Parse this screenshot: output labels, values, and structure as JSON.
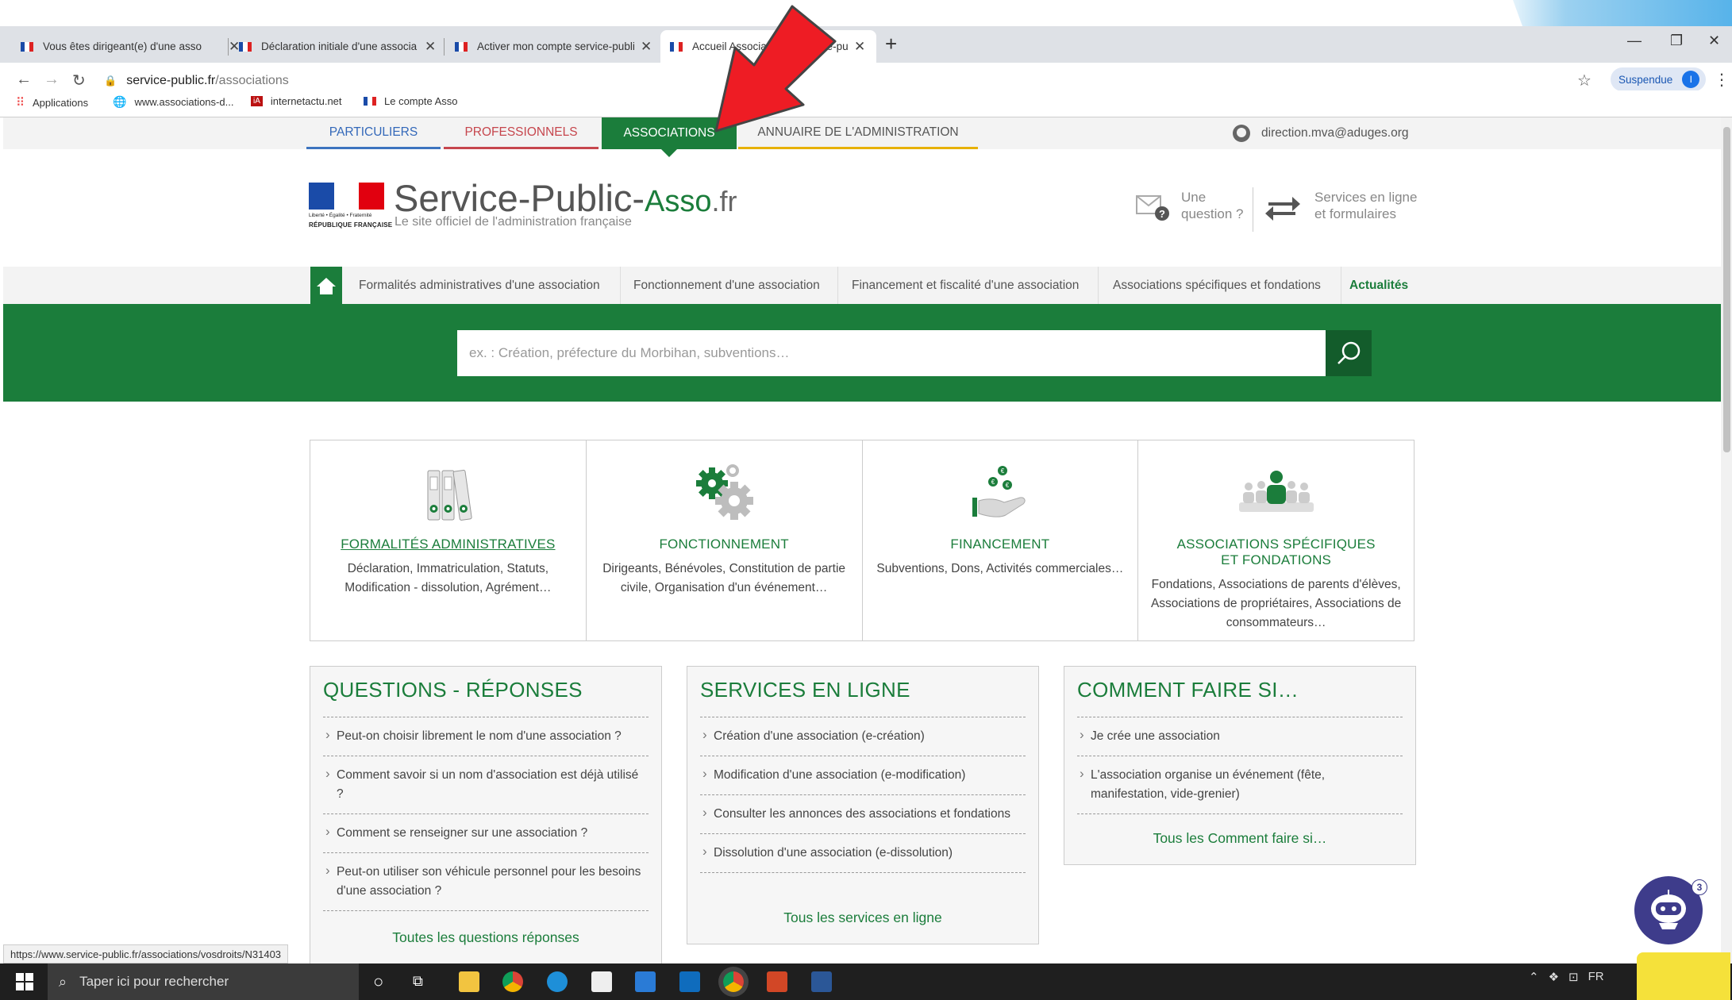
{
  "browser": {
    "tabs": [
      {
        "label": "Vous êtes dirigeant(e) d'une asso",
        "active": false
      },
      {
        "label": "Déclaration initiale d'une associa",
        "active": false
      },
      {
        "label": "Activer mon compte service-publi",
        "active": false
      },
      {
        "label": "Accueil Associations - service-pub",
        "active": true
      }
    ],
    "url_host": "service-public.fr",
    "url_path": "/associations",
    "profile_label": "Suspendue",
    "profile_initial": "I",
    "bookmarks": [
      "Applications",
      "www.associations-d...",
      "internetactu.net",
      "Le compte Asso"
    ]
  },
  "site": {
    "topnav": {
      "particuliers": "PARTICULIERS",
      "professionnels": "PROFESSIONNELS",
      "associations": "ASSOCIATIONS",
      "annuaire": "ANNUAIRE DE L'ADMINISTRATION"
    },
    "user_email": "direction.mva@aduges.org",
    "logo": {
      "motto": "Liberté • Égalité • Fraternité",
      "rf": "RÉPUBLIQUE FRANÇAISE"
    },
    "brand": {
      "main": "Service-Public-",
      "asso": "Asso",
      "fr": ".fr"
    },
    "tagline": "Le site officiel de l'administration française",
    "header_links": {
      "question_line1": "Une",
      "question_line2": "question ?",
      "services_line1": "Services en ligne",
      "services_line2": "et formulaires"
    },
    "mainnav": [
      "Formalités administratives d'une association",
      "Fonctionnement d'une association",
      "Financement et fiscalité d'une association",
      "Associations spécifiques et fondations",
      "Actualités"
    ],
    "search_placeholder": "ex. : Création, préfecture du Morbihan, subventions…",
    "categories": [
      {
        "title": "FORMALITÉS ADMINISTRATIVES",
        "desc": "Déclaration, Immatriculation, Statuts, Modification - dissolution, Agrément…",
        "icon": "binders-icon"
      },
      {
        "title": "FONCTIONNEMENT",
        "desc": "Dirigeants, Bénévoles, Constitution de partie civile, Organisation d'un événement…",
        "icon": "gears-icon"
      },
      {
        "title": "FINANCEMENT",
        "desc": "Subventions, Dons, Activités commerciales…",
        "icon": "money-hand-icon"
      },
      {
        "title_line1": "ASSOCIATIONS SPÉCIFIQUES",
        "title_line2": "ET FONDATIONS",
        "desc": "Fondations, Associations de parents d'élèves, Associations de propriétaires, Associations de consommateurs…",
        "icon": "group-icon"
      }
    ],
    "qa": {
      "title": "QUESTIONS - RÉPONSES",
      "items": [
        "Peut-on choisir librement le nom d'une association ?",
        "Comment savoir si un nom d'association est déjà utilisé ?",
        "Comment se renseigner sur une association ?",
        "Peut-on utiliser son véhicule personnel pour les besoins d'une association ?"
      ],
      "more": "Toutes les questions réponses"
    },
    "services": {
      "title": "SERVICES EN LIGNE",
      "items": [
        "Création d'une association (e-création)",
        "Modification d'une association (e-modification)",
        "Consulter les annonces des associations et fondations",
        "Dissolution d'une association (e-dissolution)"
      ],
      "more": "Tous les services en ligne"
    },
    "howto": {
      "title": "COMMENT FAIRE SI…",
      "items": [
        "Je crée une association",
        "L'association organise un événement (fête, manifestation, vide-grenier)"
      ],
      "more": "Tous les Comment faire si…"
    },
    "chatbot_badge": "3"
  },
  "status_url": "https://www.service-public.fr/associations/vosdroits/N31403",
  "taskbar": {
    "search_placeholder": "Taper ici pour rechercher",
    "lang": "FR"
  },
  "colors": {
    "green": "#1b7d3b",
    "blue": "#3368b9",
    "red": "#c6464d",
    "yellow": "#e7b100"
  }
}
